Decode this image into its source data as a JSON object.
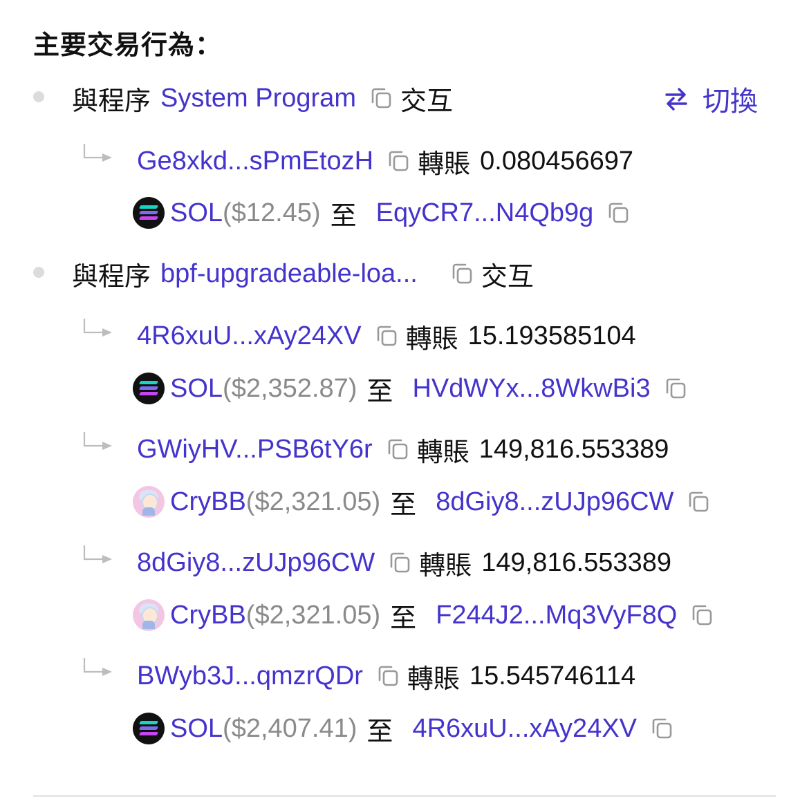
{
  "title": "主要交易行為：",
  "toggle_label": "切換",
  "interact_prefix": "與程序",
  "interact_suffix": "交互",
  "transfer_word": "轉賬",
  "to_word": "至",
  "colors": {
    "link": "#4433cc",
    "muted": "#8a8a8a",
    "bullet": "#dcdcdc"
  },
  "groups": [
    {
      "program": "System Program",
      "transfers": [
        {
          "from": "Ge8xkd...sPmEtozH",
          "amount": "0.080456697",
          "token": "SOL",
          "token_icon": "solana-icon",
          "usd": "($12.45)",
          "to": "EqyCR7...N4Qb9g"
        }
      ]
    },
    {
      "program": "bpf-upgradeable-loa...",
      "transfers": [
        {
          "from": "4R6xuU...xAy24XV",
          "amount": "15.193585104",
          "token": "SOL",
          "token_icon": "solana-icon",
          "usd": "($2,352.87)",
          "to": "HVdWYx...8WkwBi3"
        },
        {
          "from": "GWiyHV...PSB6tY6r",
          "amount": "149,816.553389",
          "token": "CryBB",
          "token_icon": "crybb-icon",
          "usd": "($2,321.05)",
          "to": "8dGiy8...zUJp96CW"
        },
        {
          "from": "8dGiy8...zUJp96CW",
          "amount": "149,816.553389",
          "token": "CryBB",
          "token_icon": "crybb-icon",
          "usd": "($2,321.05)",
          "to": "F244J2...Mq3VyF8Q"
        },
        {
          "from": "BWyb3J...qmzrQDr",
          "amount": "15.545746114",
          "token": "SOL",
          "token_icon": "solana-icon",
          "usd": "($2,407.41)",
          "to": "4R6xuU...xAy24XV"
        }
      ]
    }
  ]
}
